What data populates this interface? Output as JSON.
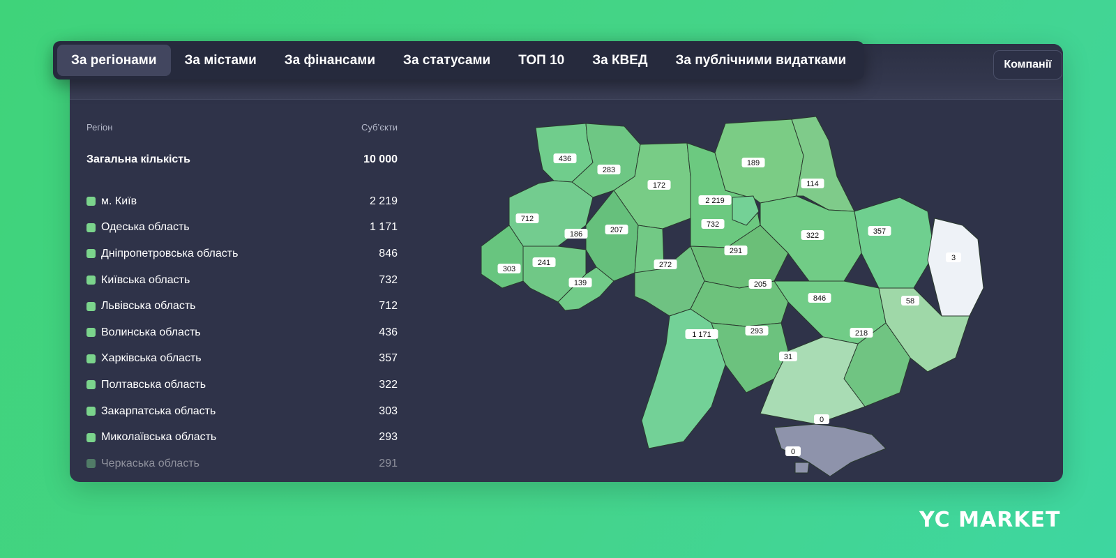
{
  "tabs": [
    {
      "label": "За регіонами",
      "active": true
    },
    {
      "label": "За містами",
      "active": false
    },
    {
      "label": "За фінансами",
      "active": false
    },
    {
      "label": "За статусами",
      "active": false
    },
    {
      "label": "ТОП 10",
      "active": false
    },
    {
      "label": "За КВЕД",
      "active": false
    },
    {
      "label": "За публічними видатками",
      "active": false
    }
  ],
  "companies_button": "Компанії",
  "table": {
    "col_region": "Регіон",
    "col_subjects": "Суб’єкти",
    "total_label": "Загальна кількість",
    "total_value": "10 000",
    "rows": [
      {
        "name": "м. Київ",
        "value": "2 219"
      },
      {
        "name": "Одеська область",
        "value": "1 171"
      },
      {
        "name": "Дніпропетровська область",
        "value": "846"
      },
      {
        "name": "Київська область",
        "value": "732"
      },
      {
        "name": "Львівська область",
        "value": "712"
      },
      {
        "name": "Волинська область",
        "value": "436"
      },
      {
        "name": "Харківська область",
        "value": "357"
      },
      {
        "name": "Полтавська область",
        "value": "322"
      },
      {
        "name": "Закарпатська область",
        "value": "303"
      },
      {
        "name": "Миколаївська область",
        "value": "293"
      },
      {
        "name": "Черкаська область",
        "value": "291"
      }
    ]
  },
  "map": {
    "labels": [
      "436",
      "283",
      "172",
      "189",
      "114",
      "712",
      "2 219",
      "186",
      "207",
      "732",
      "322",
      "357",
      "3",
      "303",
      "241",
      "291",
      "272",
      "139",
      "205",
      "846",
      "58",
      "1 171",
      "293",
      "218",
      "31",
      "0",
      "0"
    ]
  },
  "colors": {
    "swatch": "#7bd48c",
    "accent": "#42465f"
  },
  "logo": "YC MARKET"
}
